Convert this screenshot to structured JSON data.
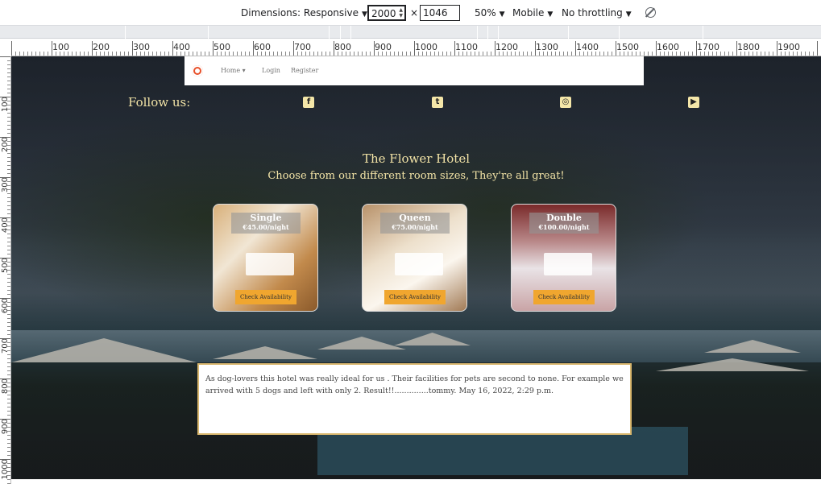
{
  "devtools": {
    "dimensions_label": "Dimensions: Responsive",
    "width_value": "2000",
    "times": "×",
    "height_value": "1046",
    "zoom": "50%",
    "device": "Mobile",
    "throttling": "No throttling",
    "icons": [
      "caret-down-icon",
      "rotate-disabled-icon"
    ]
  },
  "rulers": {
    "horizontal": [
      "100",
      "200",
      "300",
      "400",
      "500",
      "600",
      "700",
      "800",
      "900",
      "1000",
      "1100",
      "1200",
      "1300",
      "1400",
      "1500",
      "1600",
      "1700",
      "1800",
      "1900"
    ],
    "vertical": [
      "100",
      "200",
      "300",
      "400",
      "500",
      "600",
      "700",
      "800",
      "900",
      "1000"
    ]
  },
  "site": {
    "nav": {
      "home": "Home",
      "home_caret": "▾",
      "login": "Login",
      "register": "Register"
    },
    "follow_label": "Follow us:",
    "social_icons": [
      "facebook-icon",
      "twitter-icon",
      "instagram-icon",
      "youtube-icon"
    ],
    "title": "The Flower Hotel",
    "subtitle": "Choose from our different room sizes, They're all great!",
    "rooms": [
      {
        "name": "Single",
        "price": "€45.00/night",
        "button": "Check Availability"
      },
      {
        "name": "Queen",
        "price": "€75.00/night",
        "button": "Check Availability"
      },
      {
        "name": "Double",
        "price": "€100.00/night",
        "button": "Check Availability"
      }
    ],
    "review": "As dog-lovers this hotel was really ideal for us . Their facilities for pets are second to none. For example we arrived with 5 dogs and left with only 2. Result!!..............tommy. May 16, 2022, 2:29 p.m."
  },
  "colors": {
    "accent_gold": "#f2e3a6",
    "button_orange": "#f0a62f",
    "review_border": "#d9b76e"
  }
}
